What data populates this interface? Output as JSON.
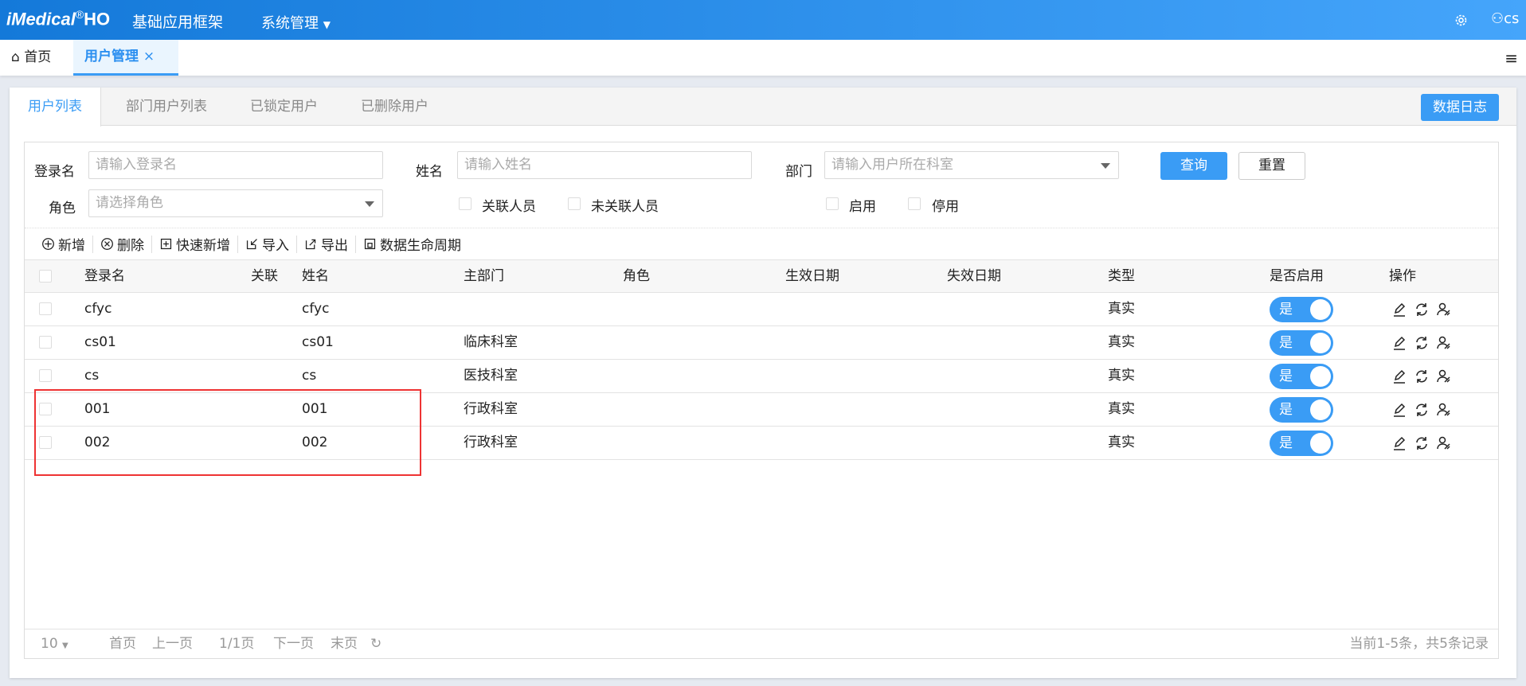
{
  "header": {
    "logo": "iMedical",
    "logo_reg": "®",
    "logo_suffix": "HO",
    "app_title": "基础应用框架",
    "menu": "系统管理",
    "user": "cs"
  },
  "page_tabs": [
    {
      "label": "首页"
    },
    {
      "label": "用户管理"
    }
  ],
  "card_tabs": [
    "用户列表",
    "部门用户列表",
    "已锁定用户",
    "已删除用户"
  ],
  "data_log_button": "数据日志",
  "search": {
    "login_label": "登录名",
    "login_placeholder": "请输入登录名",
    "name_label": "姓名",
    "name_placeholder": "请输入姓名",
    "dept_label": "部门",
    "dept_placeholder": "请输入用户所在科室",
    "query": "查询",
    "reset": "重置",
    "role_label": "角色",
    "role_placeholder": "请选择角色",
    "checks": [
      "关联人员",
      "未关联人员",
      "启用",
      "停用"
    ]
  },
  "toolbar": [
    "新增",
    "删除",
    "快速新增",
    "导入",
    "导出",
    "数据生命周期"
  ],
  "table": {
    "columns": [
      "登录名",
      "关联",
      "姓名",
      "主部门",
      "角色",
      "生效日期",
      "失效日期",
      "类型",
      "是否启用",
      "操作"
    ],
    "rows": [
      {
        "login": "cfyc",
        "name": "cfyc",
        "dept": "",
        "type": "真实",
        "enabled": "是"
      },
      {
        "login": "cs01",
        "name": "cs01",
        "dept": "临床科室",
        "type": "真实",
        "enabled": "是"
      },
      {
        "login": "cs",
        "name": "cs",
        "dept": "医技科室",
        "type": "真实",
        "enabled": "是"
      },
      {
        "login": "001",
        "name": "001",
        "dept": "行政科室",
        "type": "真实",
        "enabled": "是"
      },
      {
        "login": "002",
        "name": "002",
        "dept": "行政科室",
        "type": "真实",
        "enabled": "是"
      }
    ]
  },
  "pager": {
    "size": "10",
    "first": "首页",
    "prev": "上一页",
    "page": "1/1页",
    "next": "下一页",
    "last": "末页",
    "summary": "当前1-5条，共5条记录"
  }
}
